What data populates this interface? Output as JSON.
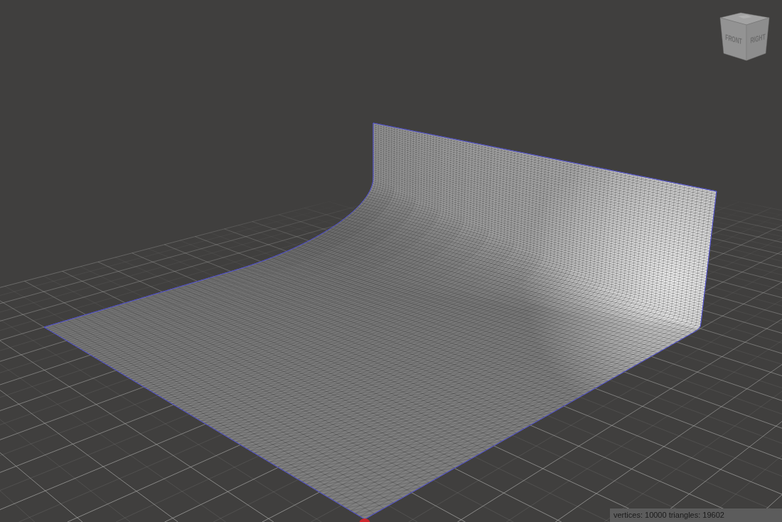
{
  "viewport": {
    "view_cube": {
      "front_label": "FRONT",
      "right_label": "RIGHT"
    },
    "status_bar": {
      "text": "vertices: 10000 triangles: 19602"
    }
  }
}
